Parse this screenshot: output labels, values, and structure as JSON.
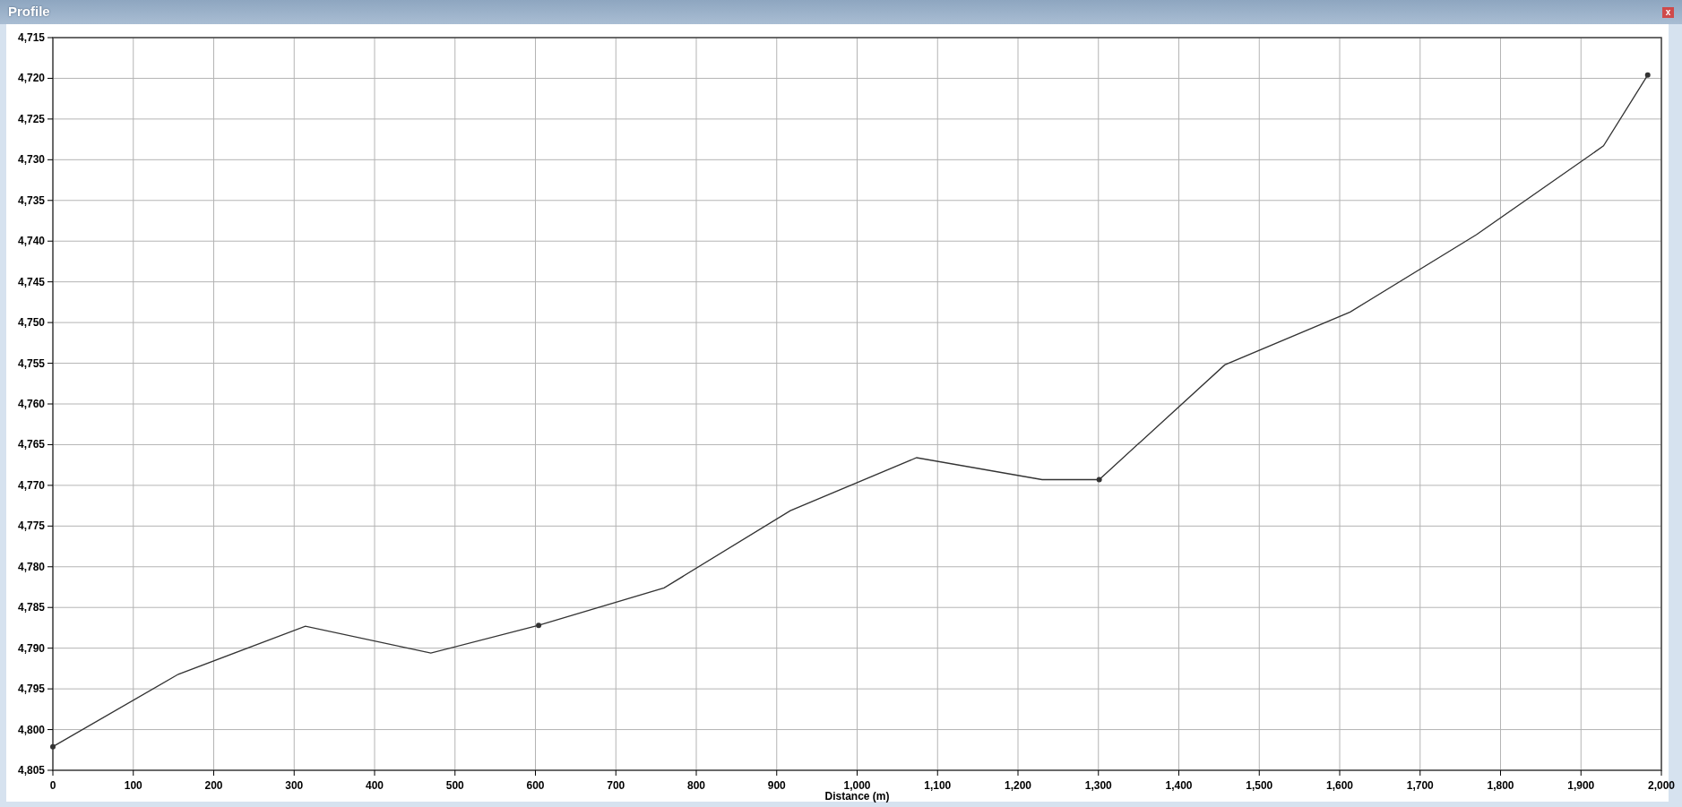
{
  "window": {
    "title": "Profile",
    "close": "x"
  },
  "chart": {
    "chart_data": {
      "type": "line",
      "xlabel": "Distance (m)",
      "grid": true,
      "xlim": [
        0,
        2000
      ],
      "ylim": [
        4805,
        4715
      ],
      "xticks": [
        {
          "value": 0,
          "label": "0"
        },
        {
          "value": 100,
          "label": "100"
        },
        {
          "value": 200,
          "label": "200"
        },
        {
          "value": 300,
          "label": "300"
        },
        {
          "value": 400,
          "label": "400"
        },
        {
          "value": 500,
          "label": "500"
        },
        {
          "value": 600,
          "label": "600"
        },
        {
          "value": 700,
          "label": "700"
        },
        {
          "value": 800,
          "label": "800"
        },
        {
          "value": 900,
          "label": "900"
        },
        {
          "value": 1000,
          "label": "1,000"
        },
        {
          "value": 1100,
          "label": "1,100"
        },
        {
          "value": 1200,
          "label": "1,200"
        },
        {
          "value": 1300,
          "label": "1,300"
        },
        {
          "value": 1400,
          "label": "1,400"
        },
        {
          "value": 1500,
          "label": "1,500"
        },
        {
          "value": 1600,
          "label": "1,600"
        },
        {
          "value": 1700,
          "label": "1,700"
        },
        {
          "value": 1800,
          "label": "1,800"
        },
        {
          "value": 1900,
          "label": "1,900"
        },
        {
          "value": 2000,
          "label": "2,000"
        }
      ],
      "yticks": [
        {
          "value": 4715,
          "label": "4,715"
        },
        {
          "value": 4720,
          "label": "4,720"
        },
        {
          "value": 4725,
          "label": "4,725"
        },
        {
          "value": 4730,
          "label": "4,730"
        },
        {
          "value": 4735,
          "label": "4,735"
        },
        {
          "value": 4740,
          "label": "4,740"
        },
        {
          "value": 4745,
          "label": "4,745"
        },
        {
          "value": 4750,
          "label": "4,750"
        },
        {
          "value": 4755,
          "label": "4,755"
        },
        {
          "value": 4760,
          "label": "4,760"
        },
        {
          "value": 4765,
          "label": "4,765"
        },
        {
          "value": 4770,
          "label": "4,770"
        },
        {
          "value": 4775,
          "label": "4,775"
        },
        {
          "value": 4780,
          "label": "4,780"
        },
        {
          "value": 4785,
          "label": "4,785"
        },
        {
          "value": 4790,
          "label": "4,790"
        },
        {
          "value": 4795,
          "label": "4,795"
        },
        {
          "value": 4800,
          "label": "4,800"
        },
        {
          "value": 4805,
          "label": "4,805"
        }
      ],
      "x": [
        0,
        156,
        314,
        470,
        604,
        760,
        917,
        1074,
        1230,
        1301,
        1457,
        1613,
        1770,
        1928,
        1983
      ],
      "series": [
        {
          "color": "#333333",
          "values": [
            4802.1,
            4793.2,
            4787.3,
            4790.6,
            4787.2,
            4782.6,
            4773.1,
            4766.6,
            4769.3,
            4769.3,
            4755.2,
            4748.7,
            4739.2,
            4728.3,
            4719.6
          ]
        }
      ]
    },
    "points": [
      {
        "marked": true
      },
      {
        "marked": false
      },
      {
        "marked": false
      },
      {
        "marked": false
      },
      {
        "marked": true
      },
      {
        "marked": false
      },
      {
        "marked": false
      },
      {
        "marked": false
      },
      {
        "marked": false
      },
      {
        "marked": true
      },
      {
        "marked": false
      },
      {
        "marked": false
      },
      {
        "marked": false
      },
      {
        "marked": false
      },
      {
        "marked": true
      }
    ]
  }
}
